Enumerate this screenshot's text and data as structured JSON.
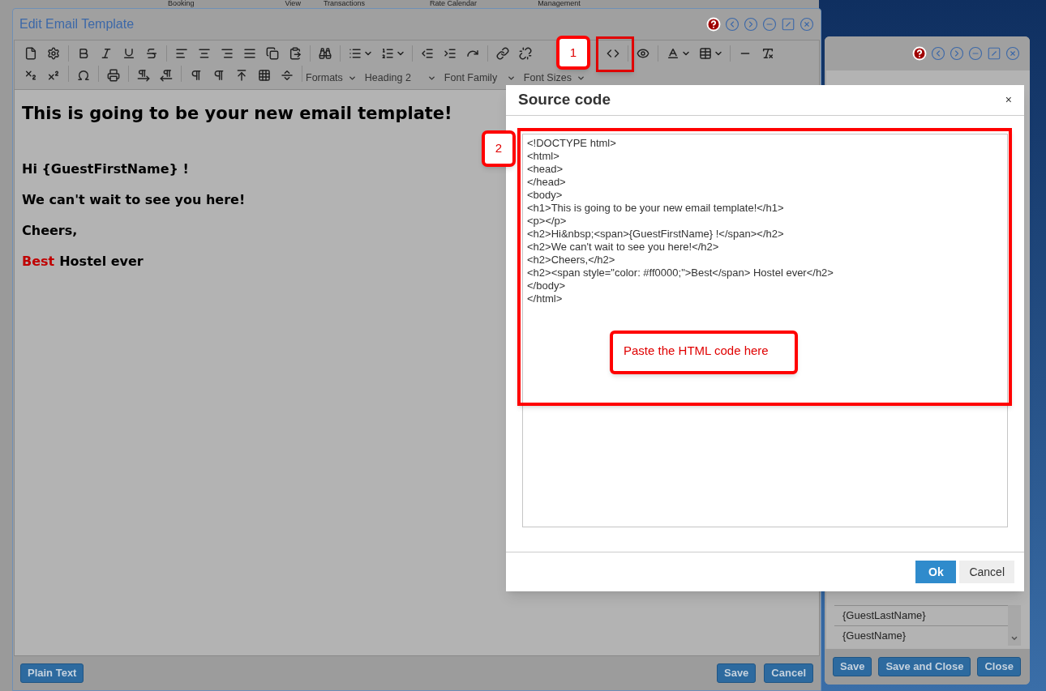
{
  "top_menu": [
    "Booking",
    "View",
    "Transactions",
    "Rate Calendar",
    "Management"
  ],
  "editor_window": {
    "title": "Edit Email Template",
    "format_dropdowns": [
      "Formats",
      "Heading 2",
      "Font Family",
      "Font Sizes"
    ],
    "content": [
      {
        "kind": "h1",
        "text": "This is going to be your new email template!"
      },
      {
        "kind": "h2",
        "text": "Hi {GuestFirstName} !"
      },
      {
        "kind": "h2",
        "text": "We can't wait to see you here!"
      },
      {
        "kind": "h2",
        "text": "Cheers,"
      },
      {
        "kind": "h2-colored",
        "colored": "Best",
        "color": "#c00000",
        "text": "Hostel ever"
      }
    ],
    "left_button": "Plain Text",
    "buttons": [
      "Save",
      "Cancel"
    ]
  },
  "back_window": {
    "items": [
      "{GuestLastName}",
      "{GuestName}"
    ],
    "buttons": [
      "Save",
      "Save and Close",
      "Close"
    ]
  },
  "dialog": {
    "title": "Source code",
    "close": "×",
    "code_lines": [
      "<!DOCTYPE html>",
      "<html>",
      "<head>",
      "</head>",
      "<body>",
      "<h1>This is going to be your new email template!</h1>",
      "<p></p>",
      "<h2>Hi&nbsp;<span>{GuestFirstName} !</span></h2>",
      "<h2>We can't wait to see you here!</h2>",
      "<h2>Cheers,</h2>",
      "<h2><span style=\"color: #ff0000;\">Best</span> Hostel ever</h2>",
      "</body>",
      "</html>"
    ],
    "buttons": [
      {
        "label": "Ok",
        "kind": "primary"
      },
      {
        "label": "Cancel",
        "kind": "secondary"
      }
    ]
  },
  "callouts": [
    {
      "kind": "number",
      "text": "1"
    },
    {
      "kind": "number",
      "text": "2"
    },
    {
      "kind": "note",
      "text": "Paste the HTML code here"
    }
  ]
}
